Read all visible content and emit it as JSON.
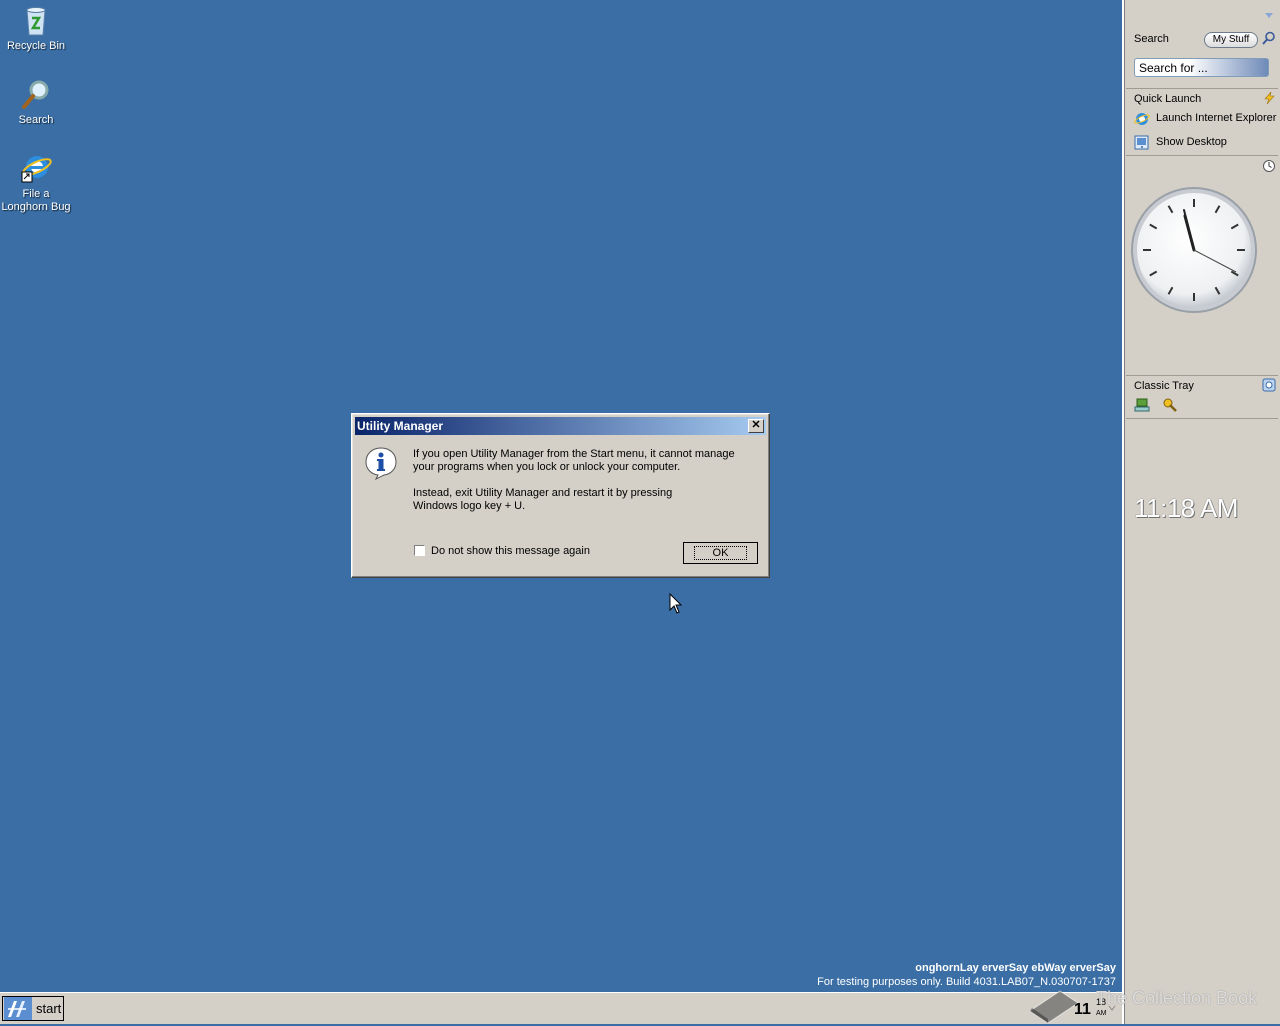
{
  "desktop": {
    "icons": [
      {
        "label": "Recycle Bin",
        "icon": "recycle-bin-icon"
      },
      {
        "label": "Search",
        "icon": "magnifier-icon"
      },
      {
        "label": "File a Longhorn Bug",
        "icon": "internet-explorer-icon"
      }
    ]
  },
  "dialog": {
    "title": "Utility Manager",
    "message1": "If you open Utility Manager from the Start menu, it cannot manage your programs when you lock or unlock your computer.",
    "message2": "Instead, exit Utility Manager and restart it by pressing Windows logo key + U.",
    "checkbox_label": "Do not show this message again",
    "checkbox_checked": false,
    "ok_label": "OK",
    "close_glyph": "✕"
  },
  "sidebar": {
    "search": {
      "title": "Search",
      "mystuff_label": "My Stuff",
      "placeholder": "Search for ..."
    },
    "quick_launch": {
      "title": "Quick Launch",
      "items": [
        {
          "label": "Launch Internet Explorer Browser",
          "icon": "internet-explorer-icon"
        },
        {
          "label": "Show Desktop",
          "icon": "show-desktop-icon"
        }
      ]
    },
    "clock": {
      "time": "11:18 AM"
    },
    "classic_tray": {
      "title": "Classic Tray"
    }
  },
  "watermark": {
    "title": "onghornLay erverSay ebWay erverSay",
    "build": "For testing purposes only. Build 4031.LAB07_N.030707-1737"
  },
  "taskbar": {
    "start_label": "start",
    "time_hour": "11",
    "time_min": "18",
    "time_ampm": "AM"
  },
  "overlay_text": "The Collection Book"
}
